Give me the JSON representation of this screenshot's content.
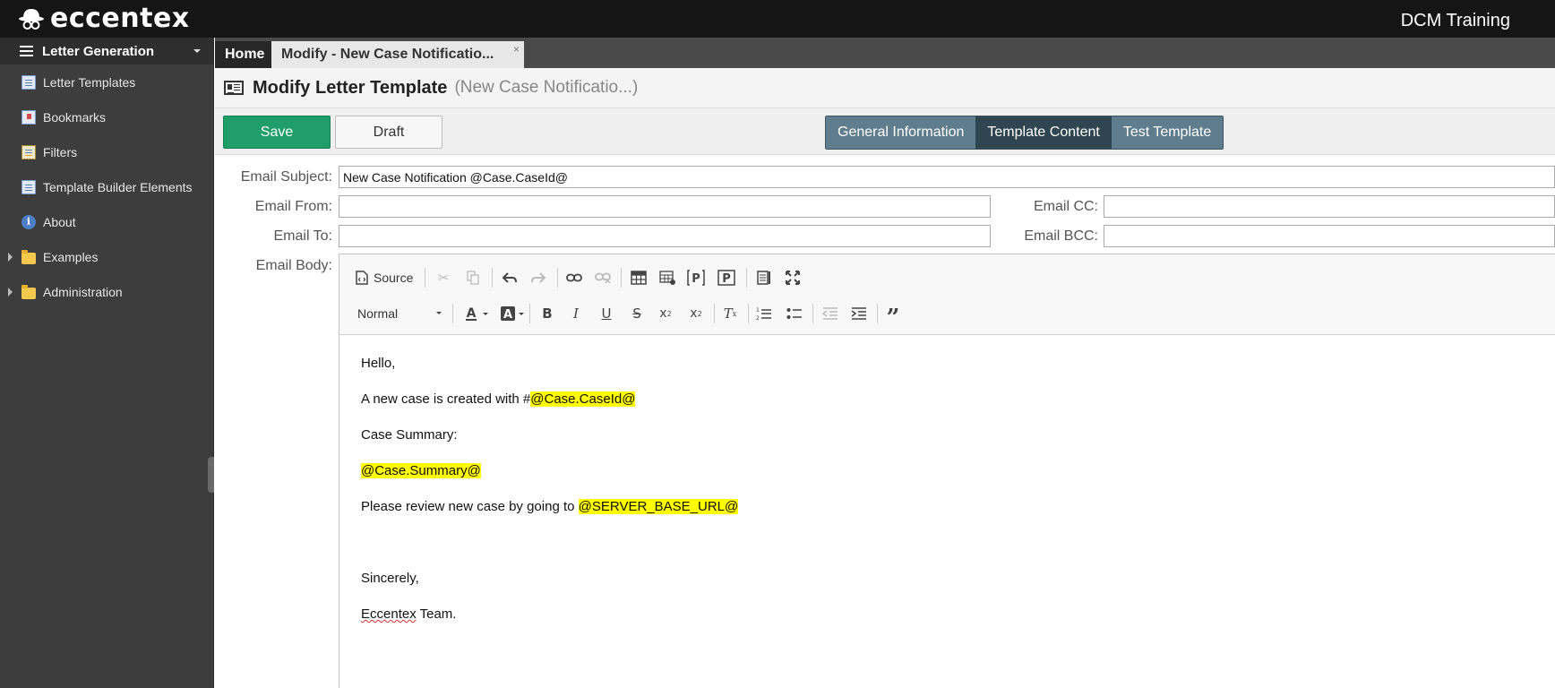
{
  "app": {
    "logo_text": "eccentex",
    "environment": "DCM Training"
  },
  "sidebar": {
    "header": "Letter Generation",
    "items": [
      {
        "label": "Letter Templates"
      },
      {
        "label": "Bookmarks"
      },
      {
        "label": "Filters"
      },
      {
        "label": "Template Builder Elements"
      },
      {
        "label": "About"
      },
      {
        "label": "Examples"
      },
      {
        "label": "Administration"
      }
    ]
  },
  "tabs": {
    "home": "Home",
    "active": "Modify - New Case Notificatio...",
    "close": "×"
  },
  "page": {
    "title": "Modify Letter Template",
    "subtitle": "(New Case Notificatio...)"
  },
  "actions": {
    "save": "Save",
    "draft": "Draft",
    "sections": [
      "General Information",
      "Template Content",
      "Test Template"
    ],
    "active_section": "Template Content"
  },
  "form": {
    "subject_label": "Email Subject:",
    "subject_value": "New Case Notification @Case.CaseId@",
    "from_label": "Email From:",
    "from_value": "",
    "to_label": "Email To:",
    "to_value": "",
    "cc_label": "Email CC:",
    "cc_value": "",
    "bcc_label": "Email BCC:",
    "bcc_value": "",
    "body_label": "Email Body:"
  },
  "editor": {
    "source_label": "Source",
    "format_value": "Normal",
    "body": {
      "greeting": "Hello,",
      "line1_prefix": "A new case is created with #",
      "line1_token": "@Case.CaseId@",
      "summary_label": "Case Summary:",
      "summary_token": "@Case.Summary@",
      "review_prefix": "Please review new case by going to ",
      "review_token": "@SERVER_BASE_URL@",
      "closing": "Sincerely,",
      "signature_name": "Eccentex",
      "signature_rest": " Team."
    }
  },
  "colors": {
    "save_green": "#1f9e6a",
    "segment_blue": "#5f7d8c",
    "segment_active": "#2f4550",
    "highlight": "#ffff00"
  }
}
